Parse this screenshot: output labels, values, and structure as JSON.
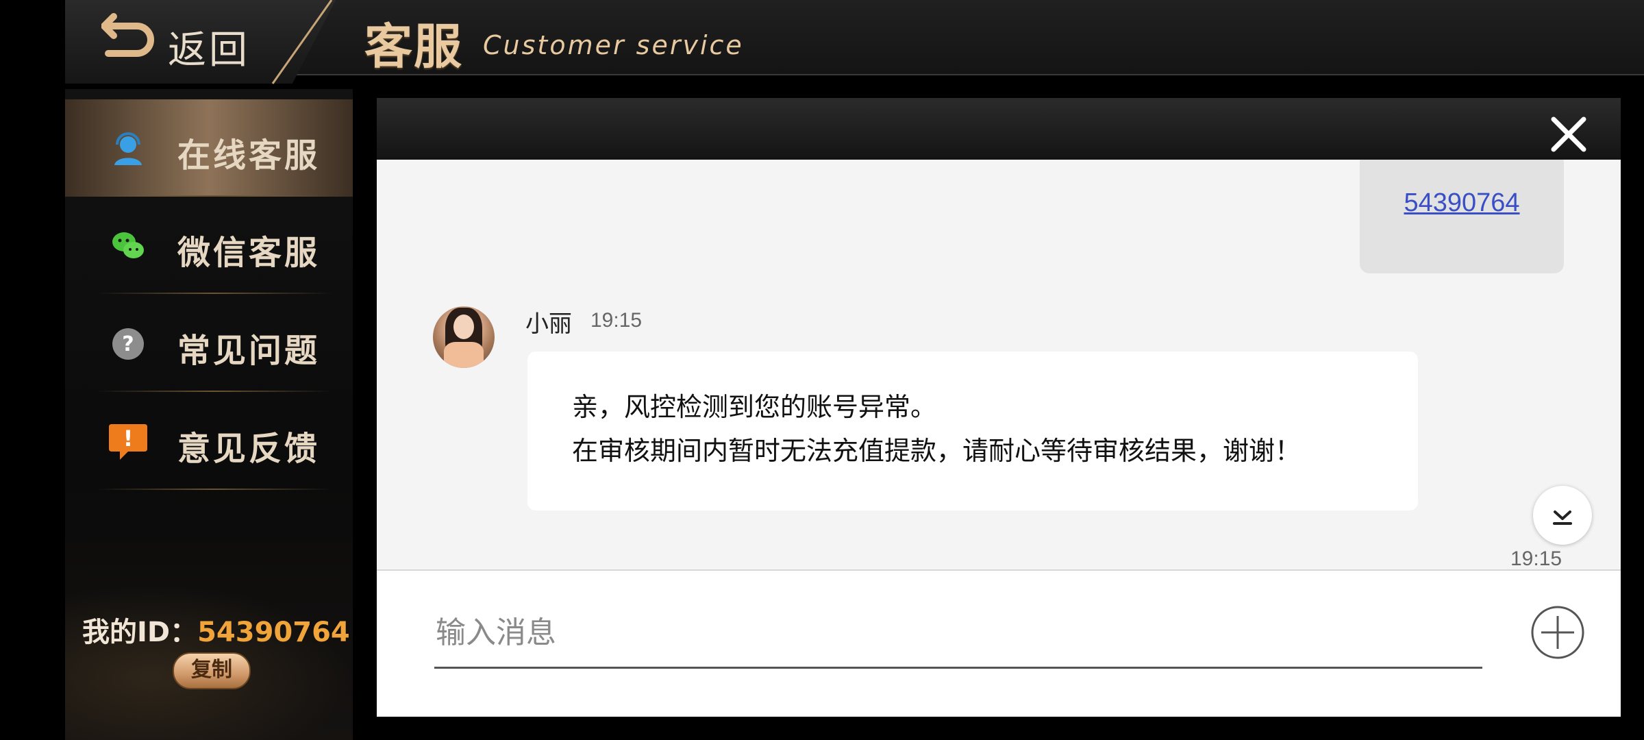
{
  "header": {
    "back_label": "返回",
    "title": "客服",
    "subtitle": "Customer service"
  },
  "sidebar": {
    "items": [
      {
        "label": "在线客服",
        "icon": "headset-agent-icon",
        "active": true
      },
      {
        "label": "微信客服",
        "icon": "wechat-icon",
        "active": false
      },
      {
        "label": "常见问题",
        "icon": "question-icon",
        "active": false
      },
      {
        "label": "意见反馈",
        "icon": "feedback-exclamation-icon",
        "active": false
      }
    ],
    "my_id_label": "我的ID：",
    "my_id_value": "54390764",
    "copy_label": "复制"
  },
  "chat": {
    "outgoing": {
      "text": "54390764"
    },
    "incoming": {
      "sender": "小丽",
      "time": "19:15",
      "line1": "亲，风控检测到您的账号异常。",
      "line2": "在审核期间内暂时无法充值提款，请耐心等待审核结果，谢谢！"
    },
    "bottom_time": "19:15"
  },
  "input": {
    "placeholder": "输入消息"
  },
  "colors": {
    "accent_gold": "#e8c9a0",
    "id_orange": "#f0a43a",
    "link_blue": "#3a4fc6"
  }
}
